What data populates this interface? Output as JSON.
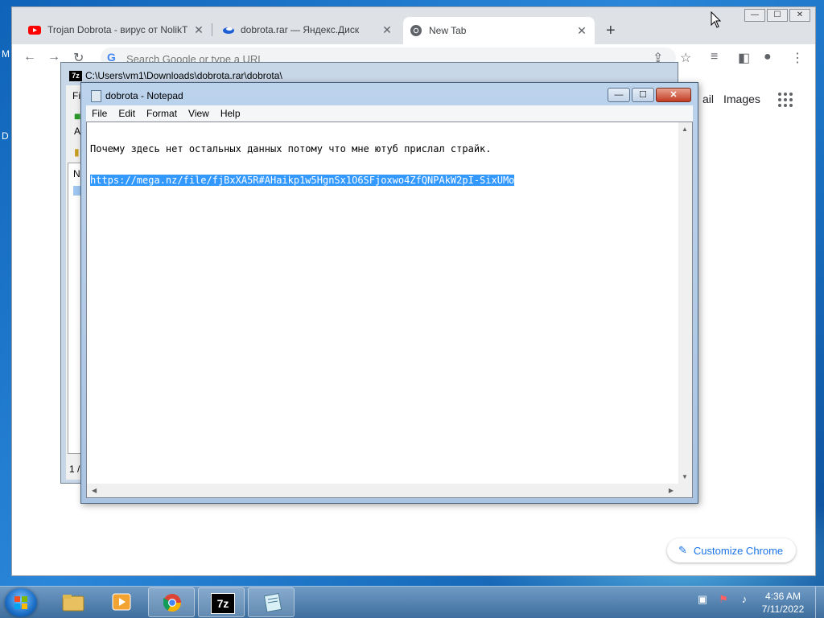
{
  "desktop": {
    "left_labels": [
      "M",
      "D"
    ]
  },
  "chrome": {
    "tabs": [
      {
        "title": "Trojan Dobrota - вирус от NolikT",
        "icon": "youtube-icon"
      },
      {
        "title": "dobrota.rar — Яндекс.Диск",
        "icon": "yandex-disk-icon"
      },
      {
        "title": "New Tab",
        "icon": "chrome-icon",
        "active": true
      }
    ],
    "omnibox_placeholder": "Search Google or type a URL",
    "omnibox_logo": "G",
    "links": {
      "gmail": "ail",
      "images": "Images"
    },
    "customize_label": "Customize Chrome",
    "new_tab_glyph": "+",
    "close_glyph": "✕"
  },
  "sevenzip": {
    "title": "C:\\Users\\vm1\\Downloads\\dobrota.rar\\dobrota\\",
    "icon_label": "7z",
    "fragments": {
      "menu_f": "Fi",
      "toolbar_a": "A",
      "list_n": "N"
    },
    "status": "1 /"
  },
  "notepad": {
    "title": "dobrota - Notepad",
    "menu": [
      "File",
      "Edit",
      "Format",
      "View",
      "Help"
    ],
    "lines": [
      "Почему здесь нет остальных данных потому что мне ютуб прислал страйк.",
      "https://mega.nz/file/fjBxXA5R#AHaikp1w5HgnSx1O6SFjoxwo4ZfQNPAkW2pI-SixUMo"
    ],
    "selected_line": 1,
    "controls": {
      "minimize": "—",
      "maximize": "☐",
      "close": "✕"
    }
  },
  "taskbar": {
    "pinned": [
      {
        "name": "explorer",
        "icon": "folder-icon"
      },
      {
        "name": "media-player",
        "icon": "media-player-icon"
      },
      {
        "name": "chrome",
        "icon": "chrome-icon"
      },
      {
        "name": "7zip",
        "icon": "7zip-icon",
        "label": "7z"
      },
      {
        "name": "notepad",
        "icon": "notepad-icon"
      }
    ],
    "clock_time": "4:36 AM",
    "clock_date": "7/11/2022"
  },
  "colors": {
    "selection": "#3399ff",
    "chrome_accent": "#1a73e8",
    "youtube_red": "#ff0000"
  }
}
